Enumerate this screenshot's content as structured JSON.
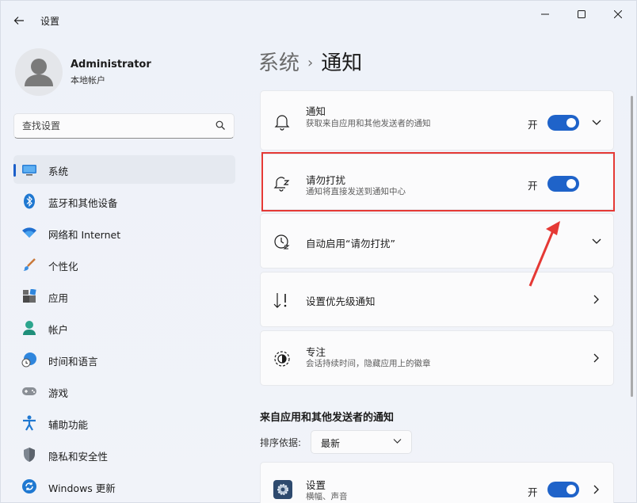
{
  "window": {
    "title": "设置",
    "controls": [
      "minimize",
      "maximize",
      "close"
    ]
  },
  "profile": {
    "name": "Administrator",
    "subtitle": "本地帐户"
  },
  "search": {
    "placeholder": "查找设置"
  },
  "sidebar": {
    "items": [
      {
        "label": "系统",
        "icon": "monitor-icon",
        "active": true
      },
      {
        "label": "蓝牙和其他设备",
        "icon": "bluetooth-icon"
      },
      {
        "label": "网络和 Internet",
        "icon": "wifi-icon"
      },
      {
        "label": "个性化",
        "icon": "brush-icon"
      },
      {
        "label": "应用",
        "icon": "apps-icon"
      },
      {
        "label": "帐户",
        "icon": "account-icon"
      },
      {
        "label": "时间和语言",
        "icon": "globe-clock-icon"
      },
      {
        "label": "游戏",
        "icon": "gamepad-icon"
      },
      {
        "label": "辅助功能",
        "icon": "accessibility-icon"
      },
      {
        "label": "隐私和安全性",
        "icon": "shield-icon"
      },
      {
        "label": "Windows 更新",
        "icon": "update-icon"
      }
    ]
  },
  "breadcrumb": {
    "parent": "系统",
    "separator": "›",
    "current": "通知"
  },
  "cards": {
    "notifications": {
      "title": "通知",
      "desc": "获取来自应用和其他发送者的通知",
      "state": "开",
      "toggle_on": true
    },
    "dnd": {
      "title": "请勿打扰",
      "desc": "通知将直接发送到通知中心",
      "state": "开",
      "toggle_on": true
    },
    "auto_dnd": {
      "title": "自动启用“请勿打扰”"
    },
    "priority": {
      "title": "设置优先级通知"
    },
    "focus": {
      "title": "专注",
      "desc": "会话持续时间，隐藏应用上的徽章"
    },
    "settings_app": {
      "title": "设置",
      "desc": "横幅、声音",
      "state": "开",
      "toggle_on": true
    }
  },
  "section": {
    "heading": "来自应用和其他发送者的通知",
    "sort_label": "排序依据:",
    "sort_value": "最新"
  },
  "colors": {
    "accent": "#1f63c9",
    "highlight": "#e53935"
  }
}
